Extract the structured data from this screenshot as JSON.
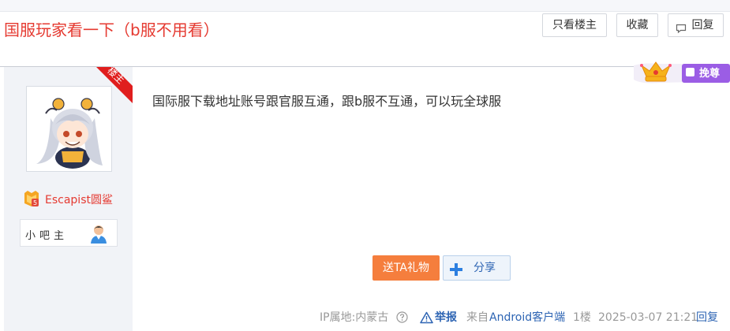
{
  "post": {
    "title": "国服玩家看一下（b服不用看）",
    "content": "国际服下载地址账号跟官服互通，跟b服不互通，可以玩全球服"
  },
  "actions": {
    "only_op": "只看楼主",
    "favorite": "收藏",
    "reply": "回复"
  },
  "author": {
    "op_ribbon": "楼主",
    "username": "Escapist圆鲨",
    "level": "5",
    "role": "小吧主"
  },
  "badge": {
    "label": "挽尊"
  },
  "buttons": {
    "gift": "送TA礼物",
    "share": "分享"
  },
  "tail": {
    "ip": "IP属地:内蒙古",
    "report": "举报",
    "from": "来自",
    "client": "Android客户端",
    "floor": "1楼",
    "time": "2025-03-07 21:21",
    "reply": "回复"
  },
  "colors": {
    "title_red": "#e53a31",
    "link_blue": "#2d64b3",
    "gift_orange": "#f57e3d",
    "ribbon_red": "#e01e1e",
    "badge_purple": "#9b5de5"
  }
}
